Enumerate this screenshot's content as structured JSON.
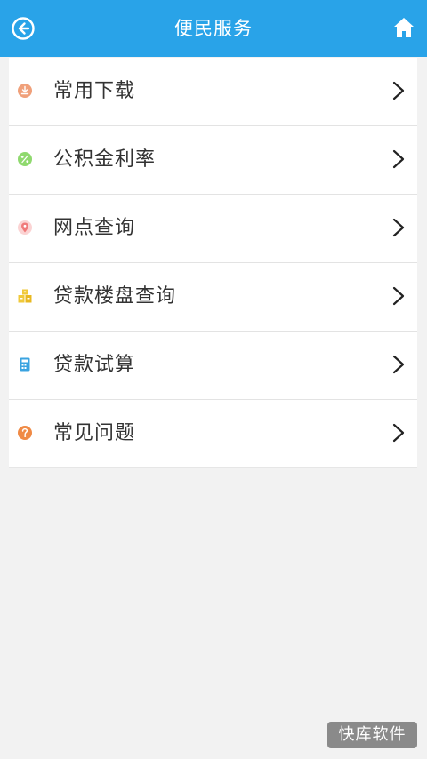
{
  "header": {
    "title": "便民服务",
    "back_icon": "back-arrow-icon",
    "home_icon": "home-icon",
    "background": "#29a3e8"
  },
  "menu": {
    "items": [
      {
        "label": "常用下载",
        "icon": "download-icon",
        "icon_color": "#f0a07a"
      },
      {
        "label": "公积金利率",
        "icon": "percent-icon",
        "icon_color": "#8fd96e"
      },
      {
        "label": "网点查询",
        "icon": "location-pin-icon",
        "icon_color": "#f7a0a0"
      },
      {
        "label": "贷款楼盘查询",
        "icon": "buildings-icon",
        "icon_color": "#f0c93a"
      },
      {
        "label": "贷款试算",
        "icon": "calculator-icon",
        "icon_color": "#3aa3e0"
      },
      {
        "label": "常见问题",
        "icon": "question-icon",
        "icon_color": "#f08a45"
      }
    ]
  },
  "watermark": {
    "text": "快库软件"
  }
}
